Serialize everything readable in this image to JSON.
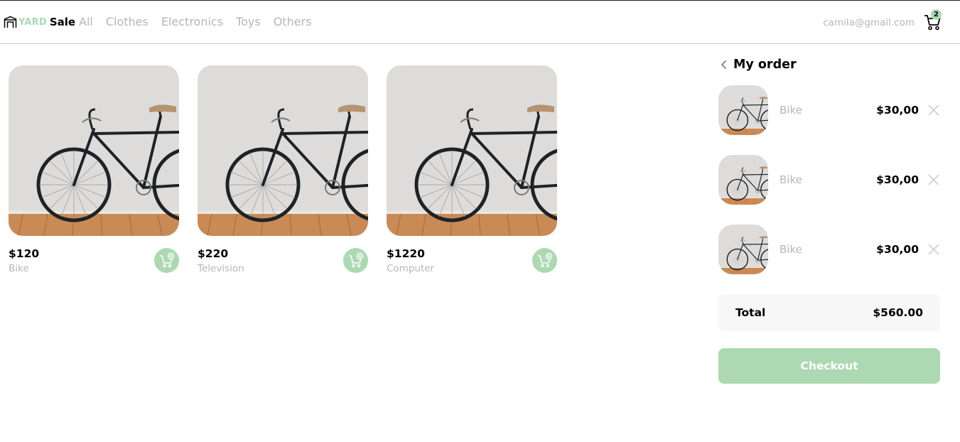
{
  "brand": {
    "yard": "YARD",
    "sale": "Sale",
    "logo_icon": "storefront-icon"
  },
  "nav": {
    "items": [
      {
        "label": "All"
      },
      {
        "label": "Clothes"
      },
      {
        "label": "Electronics"
      },
      {
        "label": "Toys"
      },
      {
        "label": "Others"
      }
    ]
  },
  "account": {
    "email": "camila@gmail.com"
  },
  "cart": {
    "count": "2",
    "icon": "shopping-cart-icon"
  },
  "products": [
    {
      "price": "$120",
      "name": "Bike",
      "image": "bicycle-photo"
    },
    {
      "price": "$220",
      "name": "Television",
      "image": "bicycle-photo"
    },
    {
      "price": "$1220",
      "name": "Computer",
      "image": "bicycle-photo"
    }
  ],
  "order": {
    "title": "My order",
    "items": [
      {
        "name": "Bike",
        "price": "$30,00"
      },
      {
        "name": "Bike",
        "price": "$30,00"
      },
      {
        "name": "Bike",
        "price": "$30,00"
      }
    ],
    "total_label": "Total",
    "total_value": "$560.00",
    "checkout_label": "Checkout"
  },
  "colors": {
    "accent": "#acd9b2",
    "muted_text": "#b6b6b6",
    "total_bg": "#f7f7f7"
  }
}
